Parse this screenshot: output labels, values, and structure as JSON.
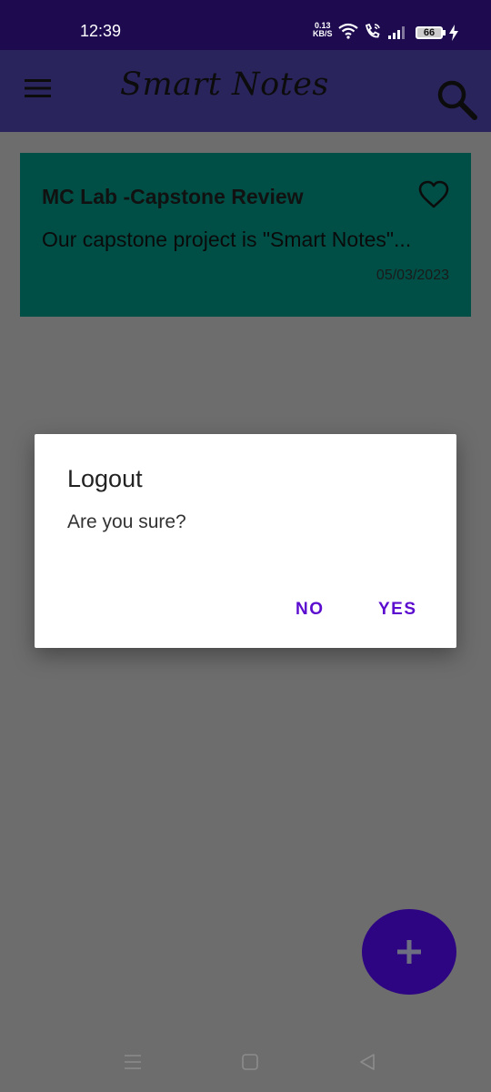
{
  "status_bar": {
    "time": "12:39",
    "net_speed_value": "0.13",
    "net_speed_unit": "KB/S",
    "battery_level": "66",
    "icons": [
      "wifi-icon",
      "wifi-call-icon",
      "signal-icon",
      "battery-icon",
      "charging-icon"
    ]
  },
  "app_bar": {
    "title": "Smart Notes",
    "icons": [
      "menu-icon",
      "search-icon"
    ]
  },
  "notes": [
    {
      "title": "MC Lab -Capstone Review",
      "preview": "Our capstone project is \"Smart Notes\"...",
      "date": "05/03/2023",
      "icon": "heart-outline-icon"
    }
  ],
  "dialog": {
    "title": "Logout",
    "message": "Are you sure?",
    "negative_label": "NO",
    "positive_label": "YES"
  },
  "fab": {
    "icon": "plus-icon"
  },
  "nav_bar": {
    "icons": [
      "recent-apps-icon",
      "home-icon",
      "back-icon"
    ]
  },
  "colors": {
    "status_bar": "#1d0a4f",
    "app_bar": "#2a245c",
    "card": "#004f46",
    "scrim_background": "#6d6d6d",
    "dialog_button": "#5b0ccf",
    "fab": "#2d0583"
  }
}
